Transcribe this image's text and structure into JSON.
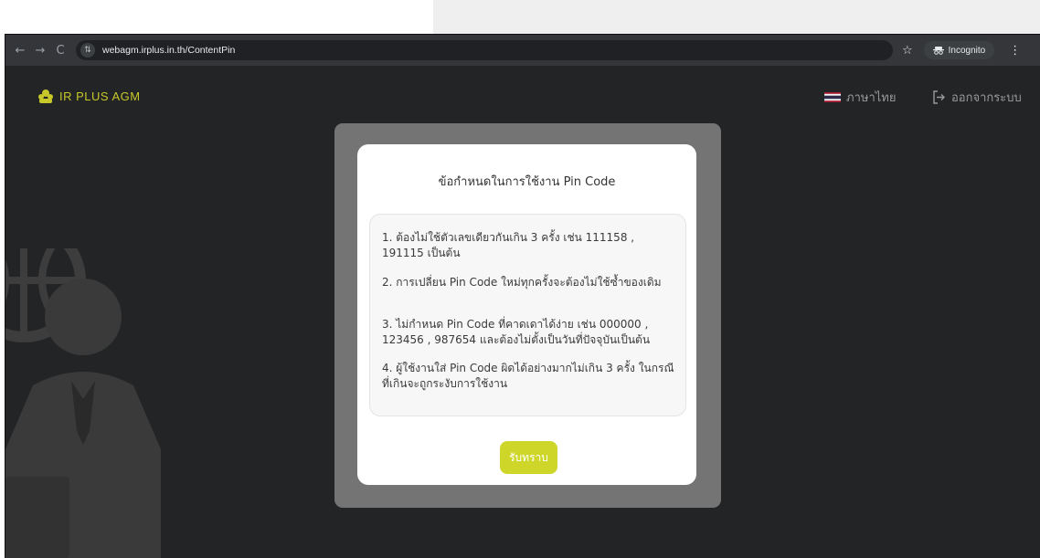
{
  "browser": {
    "url": "webagm.irplus.in.th/ContentPin",
    "incognito_label": "Incognito",
    "back_glyph": "←",
    "forward_glyph": "→",
    "reload_glyph": "C",
    "star_glyph": "☆",
    "menu_glyph": "⋮"
  },
  "header": {
    "brand_name": "IR PLUS AGM",
    "language": "ภาษาไทย",
    "logout": "ออกจากระบบ"
  },
  "modal": {
    "title": "ข้อกำหนดในการใช้งาน Pin Code",
    "rules": [
      "1. ต้องไม่ใช้ตัวเลขเดียวกันเกิน 3 ครั้ง เช่น 111158 , 191115 เป็นต้น",
      "2. การเปลี่ยน Pin Code ใหม่ทุกครั้งจะต้องไม่ใช้ซ้ำของเดิม",
      "3. ไม่กำหนด Pin Code ที่คาดเดาได้ง่าย เช่น 000000 , 123456 , 987654 และต้องไม่ตั้งเป็นวันที่ปัจจุบันเป็นต้น",
      "4. ผู้ใช้งานใส่ Pin Code ผิดได้อย่างมากไม่เกิน 3 ครั้ง ในกรณีที่เกินจะถูกระงับการใช้งาน"
    ],
    "accept_button": "รับทราบ"
  },
  "colors": {
    "accent": "#cfd62a",
    "page_bg": "#232425",
    "overlay": "#747474"
  },
  "icons": {
    "site_info": "tune-icon",
    "incognito": "incognito-icon",
    "logout": "logout-icon",
    "flag": "thai-flag-icon",
    "brand": "ir-plus-logo-icon"
  }
}
